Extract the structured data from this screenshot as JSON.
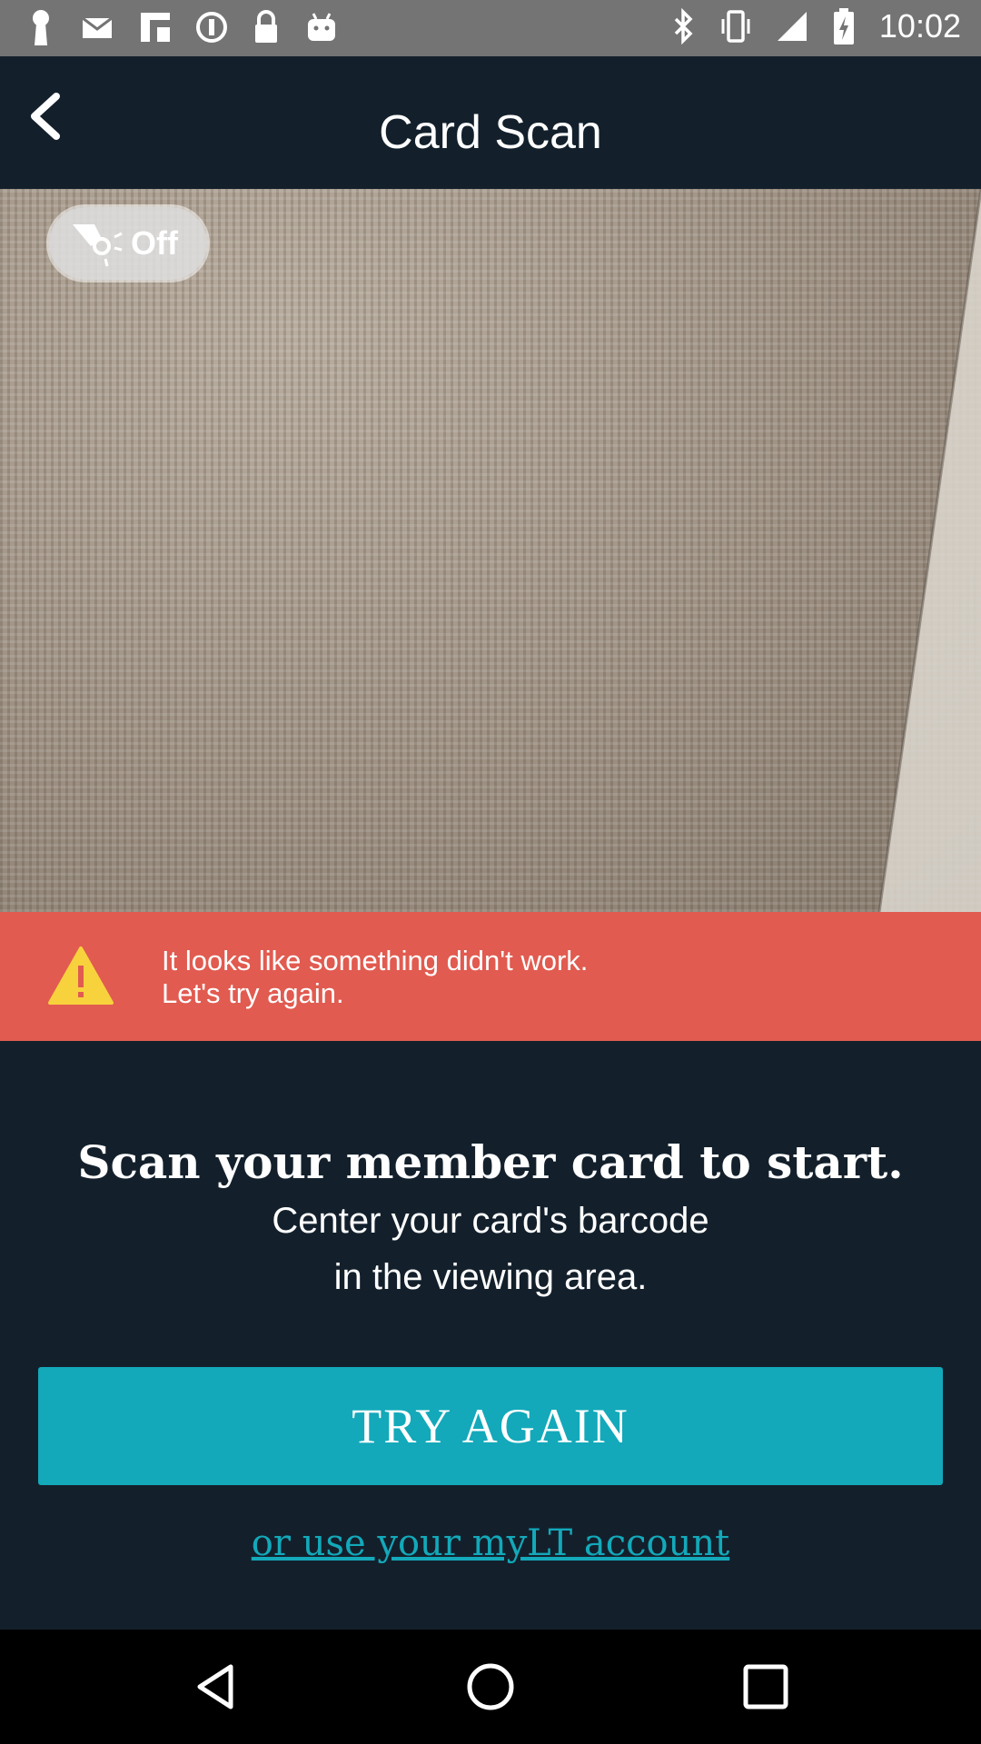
{
  "status_bar": {
    "time": "10:02",
    "left_icons": [
      "keyhole-icon",
      "mail-icon",
      "flipboard-icon",
      "info-icon",
      "lock-icon",
      "android-icon"
    ],
    "right_icons": [
      "bluetooth-icon",
      "vibrate-icon",
      "signal-icon",
      "battery-icon"
    ]
  },
  "header": {
    "title": "Card Scan",
    "back_icon": "chevron-left-icon"
  },
  "camera": {
    "flash_label": "Off",
    "flash_icon": "flashlight-icon"
  },
  "error": {
    "line1": "It looks like something didn't work.",
    "line2": "Let's try again.",
    "icon": "warning-icon",
    "color": "#e15b50"
  },
  "main": {
    "heading": "Scan your member card to start.",
    "instruction_line1": "Center your card's barcode",
    "instruction_line2": "in the viewing area."
  },
  "actions": {
    "try_again_label": "TRY AGAIN",
    "mylt_link_label": "or use your myLT account",
    "accent_color": "#13a9ba"
  },
  "nav_bar": {
    "buttons": [
      "back-triangle-icon",
      "home-circle-icon",
      "recents-square-icon"
    ]
  }
}
